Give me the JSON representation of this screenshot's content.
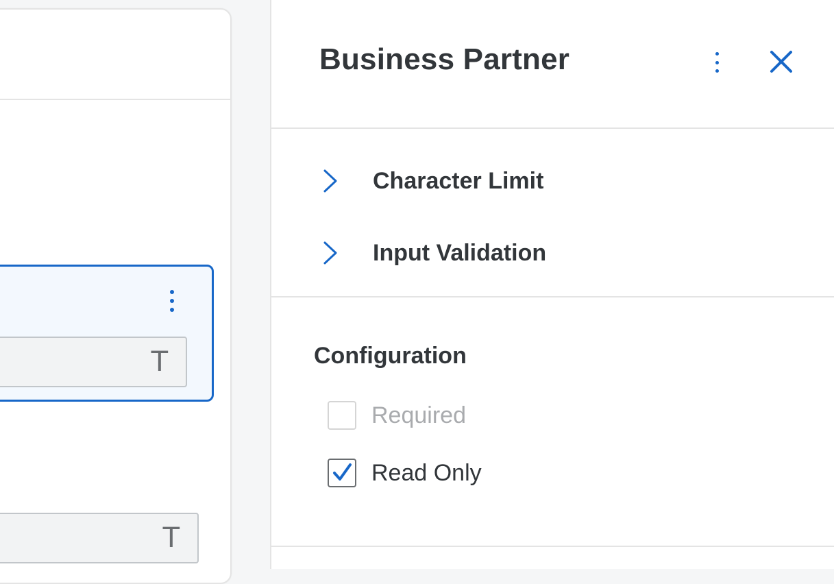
{
  "canvas": {
    "field_type_glyph": "T",
    "standalone_field_type_glyph": "T"
  },
  "panel": {
    "title": "Business Partner",
    "accordion": [
      {
        "label": "Character Limit",
        "expanded": false
      },
      {
        "label": "Input Validation",
        "expanded": false
      }
    ],
    "configuration": {
      "title": "Configuration",
      "required": {
        "label": "Required",
        "checked": false,
        "disabled": true
      },
      "read_only": {
        "label": "Read Only",
        "checked": true,
        "disabled": false
      }
    }
  },
  "colors": {
    "accent": "#1767c8",
    "text": "#32363a",
    "disabled_text": "#a9abae",
    "divider": "#e4e4e4",
    "selected_background": "#f3f8fe"
  },
  "icons": {
    "field_menu": "more-vertical-icon",
    "panel_menu": "more-vertical-icon",
    "close": "close-icon",
    "accordion_toggle": "chevron-right-icon",
    "checkmark": "checkmark-icon"
  }
}
